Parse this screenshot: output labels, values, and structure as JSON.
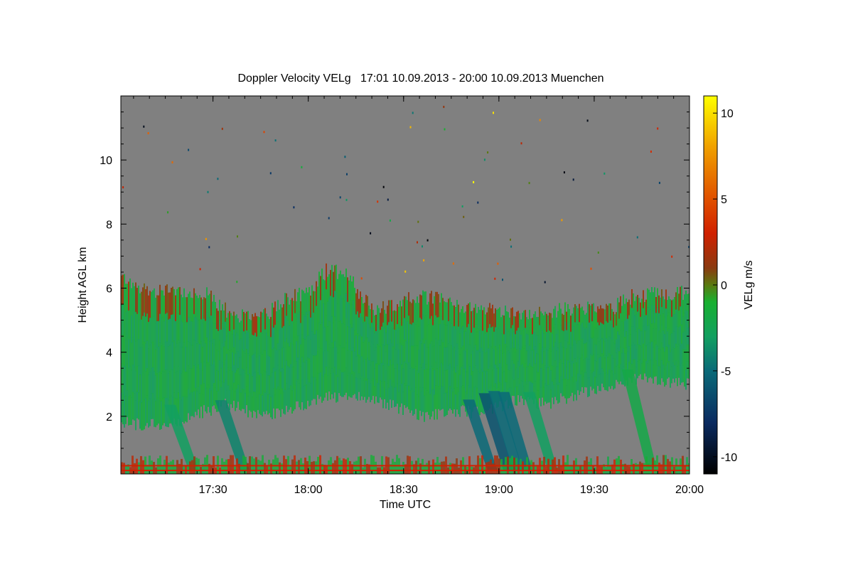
{
  "chart_data": {
    "type": "heatmap",
    "title": "Doppler Velocity VELg   17:01 10.09.2013 - 20:00 10.09.2013 Muenchen",
    "xlabel": "Time UTC",
    "ylabel": "Height AGL km",
    "xlim": [
      "17:01",
      "20:00"
    ],
    "ylim": [
      0.2,
      12.0
    ],
    "x_ticks": [
      "17:30",
      "18:00",
      "18:30",
      "19:00",
      "19:30",
      "20:00"
    ],
    "y_ticks": [
      2,
      4,
      6,
      8,
      10
    ],
    "colorbar": {
      "label": "VELg m/s",
      "range": [
        -11,
        11
      ],
      "ticks": [
        10,
        5,
        0,
        -5,
        -10
      ],
      "stops": [
        {
          "value": -11,
          "color": "#000000"
        },
        {
          "value": -8,
          "color": "#0a2a60"
        },
        {
          "value": -5,
          "color": "#0a6a78"
        },
        {
          "value": -3,
          "color": "#12a060"
        },
        {
          "value": -1,
          "color": "#18b030"
        },
        {
          "value": 0,
          "color": "#5a7a10"
        },
        {
          "value": 1,
          "color": "#8a3a10"
        },
        {
          "value": 3,
          "color": "#d02000"
        },
        {
          "value": 5,
          "color": "#e05000"
        },
        {
          "value": 8,
          "color": "#f0a000"
        },
        {
          "value": 11,
          "color": "#ffff00"
        }
      ]
    },
    "background_color": "#808080",
    "cloud_top_km": [
      {
        "time": "17:01",
        "height": 6.4
      },
      {
        "time": "17:10",
        "height": 5.9
      },
      {
        "time": "17:18",
        "height": 6.0
      },
      {
        "time": "17:28",
        "height": 5.8
      },
      {
        "time": "17:35",
        "height": 5.2
      },
      {
        "time": "17:45",
        "height": 5.1
      },
      {
        "time": "17:52",
        "height": 5.6
      },
      {
        "time": "18:00",
        "height": 5.9
      },
      {
        "time": "18:06",
        "height": 6.6
      },
      {
        "time": "18:12",
        "height": 6.4
      },
      {
        "time": "18:20",
        "height": 5.3
      },
      {
        "time": "18:28",
        "height": 5.5
      },
      {
        "time": "18:35",
        "height": 5.8
      },
      {
        "time": "18:45",
        "height": 5.5
      },
      {
        "time": "18:55",
        "height": 5.4
      },
      {
        "time": "19:05",
        "height": 5.2
      },
      {
        "time": "19:15",
        "height": 5.3
      },
      {
        "time": "19:25",
        "height": 5.4
      },
      {
        "time": "19:35",
        "height": 5.3
      },
      {
        "time": "19:40",
        "height": 5.7
      },
      {
        "time": "19:50",
        "height": 5.9
      },
      {
        "time": "20:00",
        "height": 5.8
      }
    ],
    "cloud_base_km": [
      {
        "time": "17:01",
        "height": 1.8
      },
      {
        "time": "17:15",
        "height": 1.7
      },
      {
        "time": "17:25",
        "height": 2.1
      },
      {
        "time": "17:35",
        "height": 2.4
      },
      {
        "time": "17:45",
        "height": 2.0
      },
      {
        "time": "17:55",
        "height": 2.3
      },
      {
        "time": "18:05",
        "height": 2.6
      },
      {
        "time": "18:15",
        "height": 2.7
      },
      {
        "time": "18:25",
        "height": 2.4
      },
      {
        "time": "18:35",
        "height": 2.0
      },
      {
        "time": "18:45",
        "height": 2.2
      },
      {
        "time": "18:55",
        "height": 2.1
      },
      {
        "time": "19:05",
        "height": 2.5
      },
      {
        "time": "19:15",
        "height": 2.4
      },
      {
        "time": "19:25",
        "height": 2.7
      },
      {
        "time": "19:35",
        "height": 3.0
      },
      {
        "time": "19:45",
        "height": 3.2
      },
      {
        "time": "20:00",
        "height": 3.0
      }
    ],
    "fall_streaks": [
      {
        "time": "17:24",
        "base_km": 0.3,
        "value": -3
      },
      {
        "time": "17:40",
        "base_km": 0.3,
        "value": -4
      },
      {
        "time": "18:58",
        "base_km": 0.3,
        "value": -5
      },
      {
        "time": "19:03",
        "base_km": 0.3,
        "value": -6
      },
      {
        "time": "19:06",
        "base_km": 0.3,
        "value": -5
      },
      {
        "time": "19:09",
        "base_km": 0.3,
        "value": -5
      },
      {
        "time": "19:17",
        "base_km": 0.3,
        "value": -3
      },
      {
        "time": "19:48",
        "base_km": 0.4,
        "value": -2
      }
    ]
  }
}
